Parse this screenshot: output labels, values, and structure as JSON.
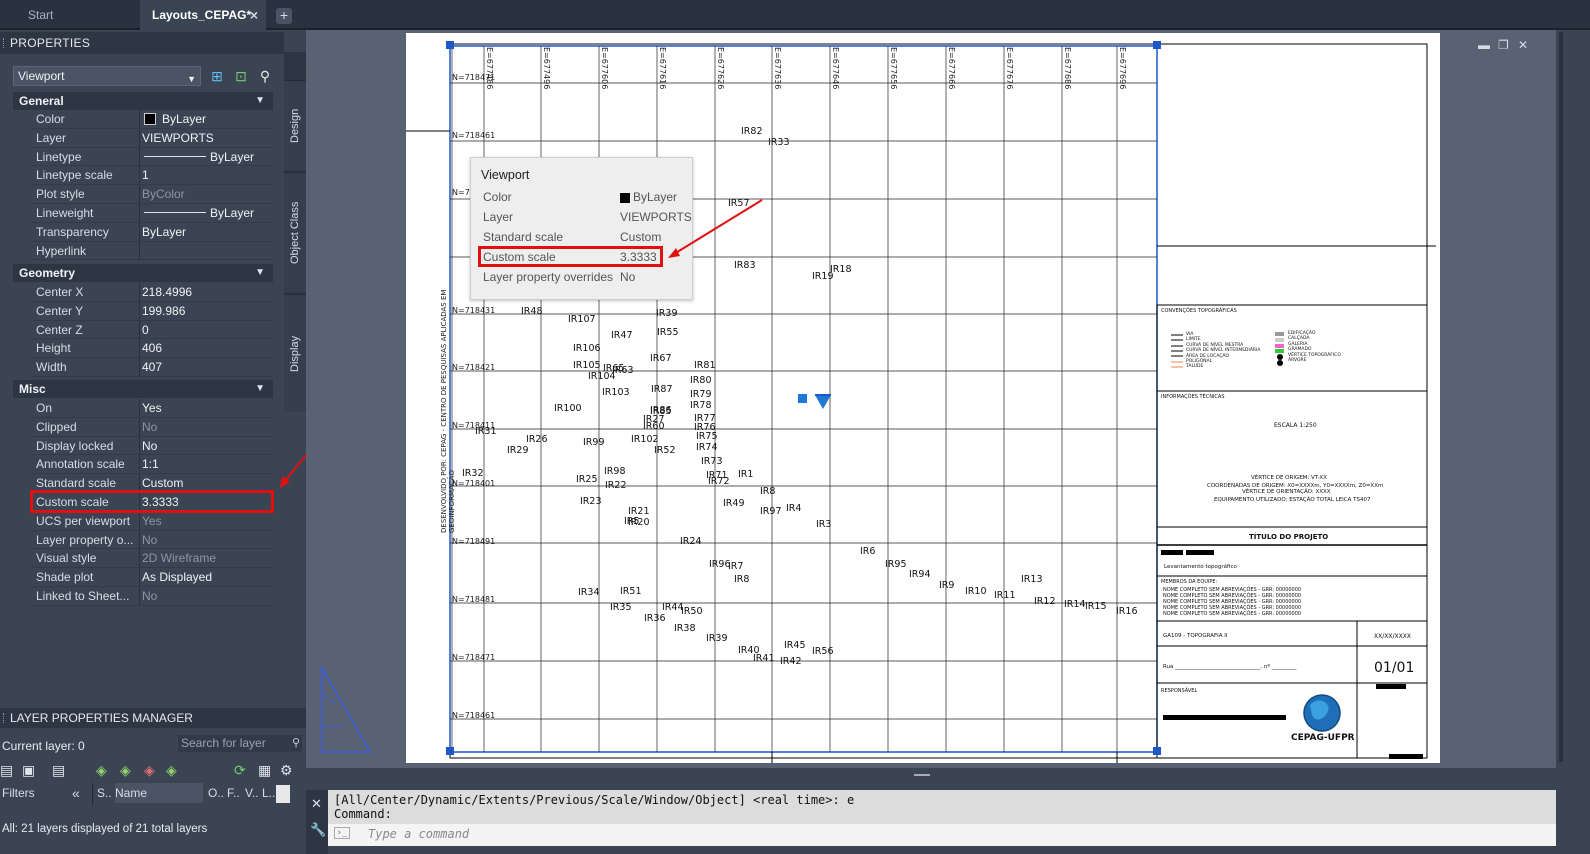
{
  "tabs": {
    "start": "Start",
    "layout": "Layouts_CEPAG*",
    "close": "×",
    "new": "+"
  },
  "properties": {
    "title": "PROPERTIES",
    "object": "Viewport",
    "side_tabs": [
      "Design",
      "Object Class",
      "Display"
    ],
    "general": {
      "label": "General",
      "rows": [
        {
          "key": "Color",
          "value": "ByLayer",
          "swatch": true
        },
        {
          "key": "Layer",
          "value": "VIEWPORTS"
        },
        {
          "key": "Linetype",
          "value": "ByLayer",
          "line": true
        },
        {
          "key": "Linetype scale",
          "value": "1"
        },
        {
          "key": "Plot style",
          "value": "ByColor",
          "dim": true
        },
        {
          "key": "Lineweight",
          "value": "ByLayer",
          "line": true
        },
        {
          "key": "Transparency",
          "value": "ByLayer"
        },
        {
          "key": "Hyperlink",
          "value": ""
        }
      ]
    },
    "geometry": {
      "label": "Geometry",
      "rows": [
        {
          "key": "Center X",
          "value": "218.4996"
        },
        {
          "key": "Center Y",
          "value": "199.986"
        },
        {
          "key": "Center Z",
          "value": "0"
        },
        {
          "key": "Height",
          "value": "406"
        },
        {
          "key": "Width",
          "value": "407"
        }
      ]
    },
    "misc": {
      "label": "Misc",
      "rows": [
        {
          "key": "On",
          "value": "Yes"
        },
        {
          "key": "Clipped",
          "value": "No",
          "dim": true
        },
        {
          "key": "Display locked",
          "value": "No"
        },
        {
          "key": "Annotation scale",
          "value": "1:1"
        },
        {
          "key": "Standard scale",
          "value": "Custom"
        },
        {
          "key": "Custom scale",
          "value": "3.3333"
        },
        {
          "key": "UCS per viewport",
          "value": "Yes",
          "dim": true
        },
        {
          "key": "Layer property o...",
          "value": "No",
          "dim": true
        },
        {
          "key": "Visual style",
          "value": "2D Wireframe",
          "dim": true
        },
        {
          "key": "Shade plot",
          "value": "As Displayed"
        },
        {
          "key": "Linked to Sheet...",
          "value": "No",
          "dim": true
        }
      ]
    }
  },
  "layer_manager": {
    "title": "LAYER PROPERTIES MANAGER",
    "current_layer": "Current layer: 0",
    "search_placeholder": "Search for layer",
    "filters_label": "Filters",
    "collapse": "«",
    "columns": [
      "S..",
      "Name",
      "O..",
      "F..",
      "V..",
      "L.."
    ],
    "status": "All: 21 layers displayed of 21 total layers"
  },
  "tooltip": {
    "title": "Viewport",
    "rows": [
      {
        "key": "Color",
        "value": "ByLayer"
      },
      {
        "key": "Layer",
        "value": "VIEWPORTS"
      },
      {
        "key": "Standard scale",
        "value": "Custom"
      },
      {
        "key": "Custom scale",
        "value": "3.3333"
      },
      {
        "key": "Layer property overrides",
        "value": "No"
      }
    ]
  },
  "command": {
    "history": "[All/Center/Dynamic/Extents/Previous/Scale/Window/Object] <real time>: e",
    "prompt": "Command:",
    "placeholder": "Type a command"
  },
  "drawing": {
    "north_labels": [
      "N=718471",
      "N=718461",
      "N=71",
      "N=718431",
      "N=718421",
      "N=718411",
      "N=718401",
      "N=718491",
      "N=718481",
      "N=718471",
      "N=718461"
    ],
    "east_labels": [
      "E=677486",
      "E=677496",
      "E=677606",
      "E=677616",
      "E=677626",
      "E=677636",
      "E=677646",
      "E=677656",
      "E=677666",
      "E=677676",
      "E=677686",
      "E=677696",
      "E=677706",
      "E=677716",
      "E=677726",
      "E=677736",
      "E=677746"
    ],
    "side_text": "DESENVOLVIDO POR: CEPAG - CENTRO DE PESQUISAS APLICADAS EM GEOINFORMAÇÃO",
    "points": [
      "IR82",
      "IR33",
      "IR57",
      "IR83",
      "IR18",
      "IR19",
      "IR48",
      "IR107",
      "IR39",
      "IR47",
      "IR55",
      "IR106",
      "IR67",
      "IR105",
      "IR65",
      "IR63",
      "IR81",
      "IR104",
      "IR80",
      "IR103",
      "IR87",
      "IR79",
      "IR100",
      "IR86",
      "IR78",
      "IR85",
      "IR77",
      "IR31",
      "IR27",
      "IR76",
      "IR60",
      "IR26",
      "IR99",
      "IR102",
      "IR75",
      "IR29",
      "IR52",
      "IR74",
      "IR73",
      "IR98",
      "IR32",
      "IR71",
      "IR1",
      "IR25",
      "IR72",
      "IR22",
      "IR8",
      "IR23",
      "IR49",
      "IR4",
      "IR21",
      "IR97",
      "IR3",
      "IR20",
      "IR5",
      "IR24",
      "IR96",
      "IR6",
      "IR95",
      "IR7",
      "IR94",
      "IR8",
      "IR9",
      "IR13",
      "IR10",
      "IR34",
      "IR51",
      "IR11",
      "IR12",
      "IR14",
      "IR15",
      "IR16",
      "IR35",
      "IR44",
      "IR50",
      "IR36",
      "IR38",
      "IR39",
      "IR45",
      "IR40",
      "IR56",
      "IR41",
      "IR42"
    ],
    "legend": {
      "title": "CONVENÇÕES TOPOGRÁFICAS",
      "left": [
        "VIA",
        "LIMITE",
        "CURVA DE NÍVEL MESTRA",
        "CURVA DE NÍVEL INTERMEDIÁRIA",
        "ÁREA DE LOCAÇÃO",
        "POLIGONAL",
        "TALUDE"
      ],
      "right": [
        "EDIFICAÇÃO",
        "CALÇADA",
        "GALERIA",
        "GRAMADO",
        "VÉRTICE TOPOGRÁFICO",
        "ÁRVORE"
      ]
    },
    "info": {
      "title": "INFORMAÇÕES TÉCNICAS",
      "scale": "ESCALA 1:250",
      "lines": [
        "VÉRTICE DE ORIGEM: VT-XX",
        "COORDENADAS DE ORIGEM: X0=XXXXm, Y0=XXXXm, Z0=XXm",
        "VÉRTICE DE ORIENTAÇÃO: XXXX",
        "EQUIPAMENTO UTILIZADO: ESTAÇÃO TOTAL LEICA TS407"
      ]
    },
    "title_block": {
      "title": "TÍTULO DO PROJETO",
      "subtitle": "Levantamento topográfico",
      "team_label": "MEMBROS DA EQUIPE:",
      "team": [
        "NOME COMPLETO SEM ABREVIAÇÕES - GRR: 00000000",
        "NOME COMPLETO SEM ABREVIAÇÕES - GRR: 00000000",
        "NOME COMPLETO SEM ABREVIAÇÕES - GRR: 00000000",
        "NOME COMPLETO SEM ABREVIAÇÕES - GRR: 00000000",
        "NOME COMPLETO SEM ABREVIAÇÕES - GRR: 00000000"
      ],
      "course": "GA109 - TOPOGRAFIA II",
      "date": "XX/XX/XXXX",
      "street": "Rua _______________________________, nº _________",
      "sheet": "01/01",
      "responsible": "RESPONSÁVEL",
      "org": "CEPAG-UFPR"
    }
  }
}
